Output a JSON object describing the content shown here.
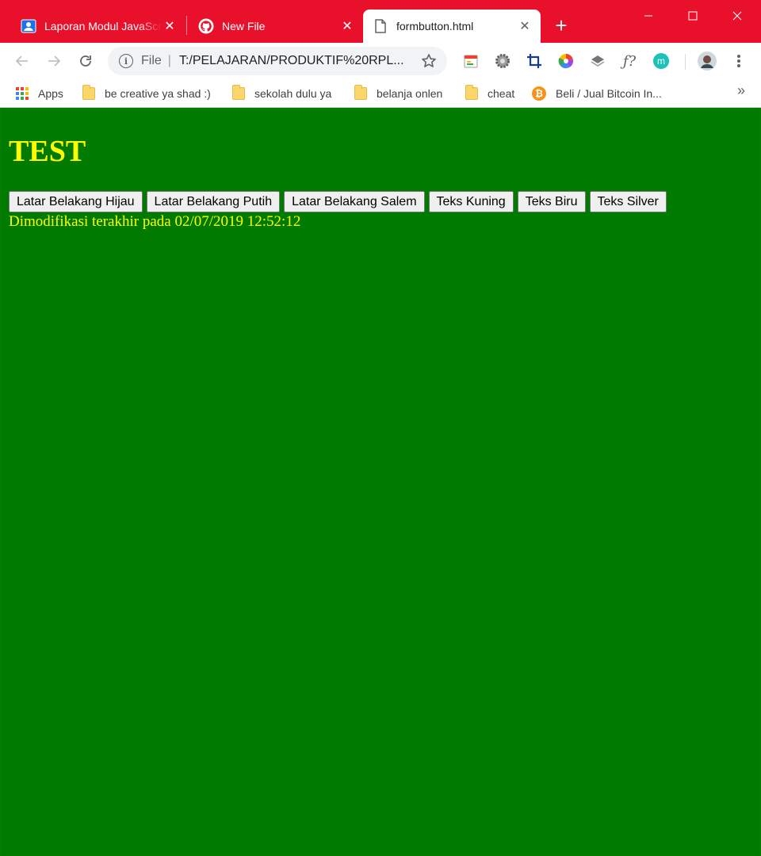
{
  "browser": {
    "tabs": [
      {
        "title": "Laporan Modul JavaScript",
        "favicon": "contacts-icon",
        "active": false
      },
      {
        "title": "New File",
        "favicon": "github-icon",
        "active": false
      },
      {
        "title": "formbutton.html",
        "favicon": "file-icon",
        "active": true
      }
    ],
    "omnibox": {
      "scheme_label": "File",
      "url": "T:/PELAJARAN/PRODUKTIF%20RPL..."
    },
    "bookmarks": [
      {
        "label": "Apps",
        "icon": "apps-grid-icon"
      },
      {
        "label": "be creative ya shad :)",
        "icon": "folder-icon"
      },
      {
        "label": "sekolah dulu ya",
        "icon": "folder-icon"
      },
      {
        "label": "belanja onlen",
        "icon": "folder-icon"
      },
      {
        "label": "cheat",
        "icon": "folder-icon"
      },
      {
        "label": "Beli / Jual Bitcoin In...",
        "icon": "bitcoin-icon"
      }
    ],
    "colors": {
      "frame": "#e81123",
      "page_bg": "#007b00",
      "page_text": "#ffff00"
    }
  },
  "page": {
    "heading": "TEST",
    "buttons": [
      "Latar Belakang Hijau",
      "Latar Belakang Putih",
      "Latar Belakang Salem",
      "Teks Kuning",
      "Teks Biru",
      "Teks Silver"
    ],
    "last_modified": "Dimodifikasi terakhir pada 02/07/2019 12:52:12"
  }
}
